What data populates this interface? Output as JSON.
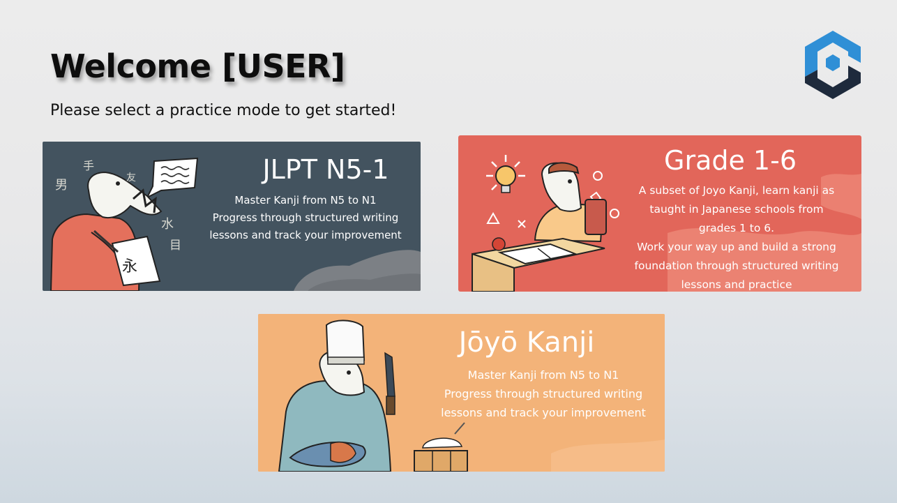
{
  "header": {
    "title": "Welcome [USER]",
    "subtitle": "Please select a practice mode to get started!",
    "logo_icon": "hexagon-cube-logo-icon"
  },
  "cards": [
    {
      "id": "jlpt",
      "title": "JLPT N5-1",
      "lines": [
        "Master Kanji from N5 to N1",
        "Progress through structured writing",
        "lessons and track your improvement"
      ],
      "kanji": [
        "男",
        "手",
        "友",
        "水",
        "目",
        "永"
      ],
      "bg_color": "#43535f"
    },
    {
      "id": "grade",
      "title": "Grade 1-6",
      "lines": [
        "A subset of Joyo Kanji, learn kanji as",
        "taught in Japanese schools from",
        "grades 1 to 6.",
        "Work your way up and build a strong",
        "foundation through structured writing",
        "lessons and practice"
      ],
      "bg_color": "#e2665a"
    },
    {
      "id": "joyo",
      "title": "Jōyō Kanji",
      "lines": [
        "Master Kanji from N5 to N1",
        "Progress through structured writing",
        "lessons and track your improvement"
      ],
      "bg_color": "#f3b379"
    }
  ]
}
